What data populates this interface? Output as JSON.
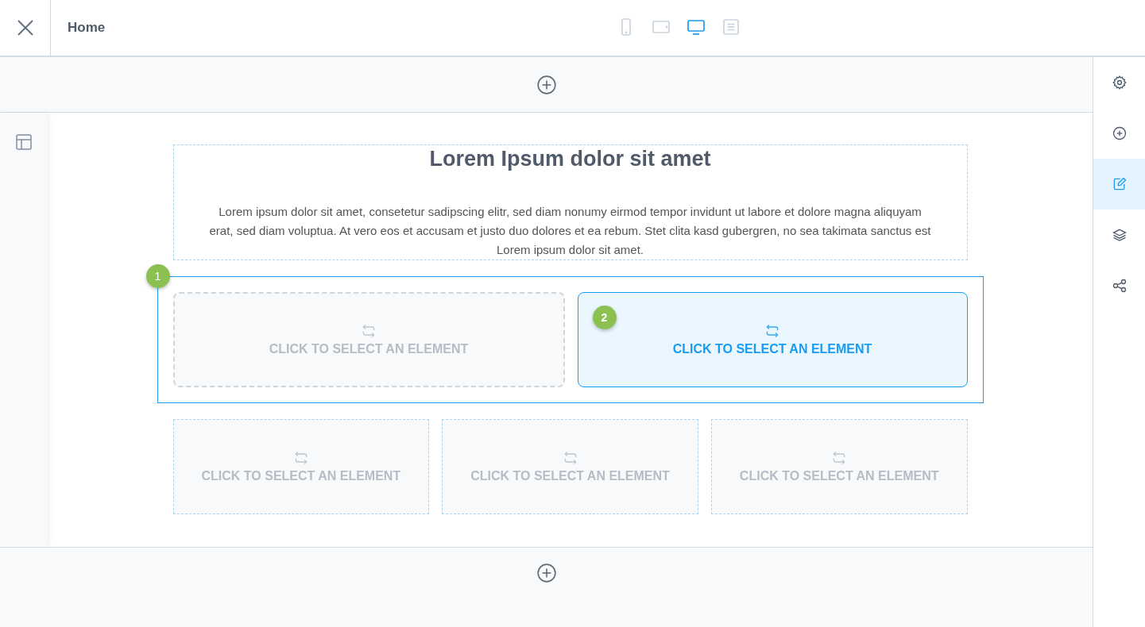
{
  "header": {
    "title": "Home"
  },
  "devices": [
    {
      "kind": "phone",
      "selected": false
    },
    {
      "kind": "tablet",
      "selected": false
    },
    {
      "kind": "desktop",
      "selected": true
    },
    {
      "kind": "document",
      "selected": false
    }
  ],
  "right_sidebar": [
    {
      "kind": "settings",
      "selected": false
    },
    {
      "kind": "add",
      "selected": false
    },
    {
      "kind": "edit",
      "selected": true
    },
    {
      "kind": "layers",
      "selected": false
    },
    {
      "kind": "share",
      "selected": false
    }
  ],
  "content": {
    "heading": "Lorem Ipsum dolor sit amet",
    "paragraph": "Lorem ipsum dolor sit amet, consetetur sadipscing elitr, sed diam nonumy eirmod tempor invidunt ut labore et dolore magna aliquyam erat, sed diam voluptua. At vero eos et accusam et justo duo dolores et ea rebum. Stet clita kasd gubergren, no sea takimata sanctus est Lorem ipsum dolor sit amet."
  },
  "rows": [
    {
      "selected": true,
      "badge": "1",
      "slots": [
        {
          "label": "CLICK TO SELECT AN ELEMENT",
          "selected": false
        },
        {
          "label": "CLICK TO SELECT AN ELEMENT",
          "selected": true,
          "badge": "2"
        }
      ]
    },
    {
      "selected": false,
      "slots": [
        {
          "label": "CLICK TO SELECT AN ELEMENT",
          "selected": false
        },
        {
          "label": "CLICK TO SELECT AN ELEMENT",
          "selected": false
        },
        {
          "label": "CLICK TO SELECT AN ELEMENT",
          "selected": false
        }
      ]
    }
  ]
}
